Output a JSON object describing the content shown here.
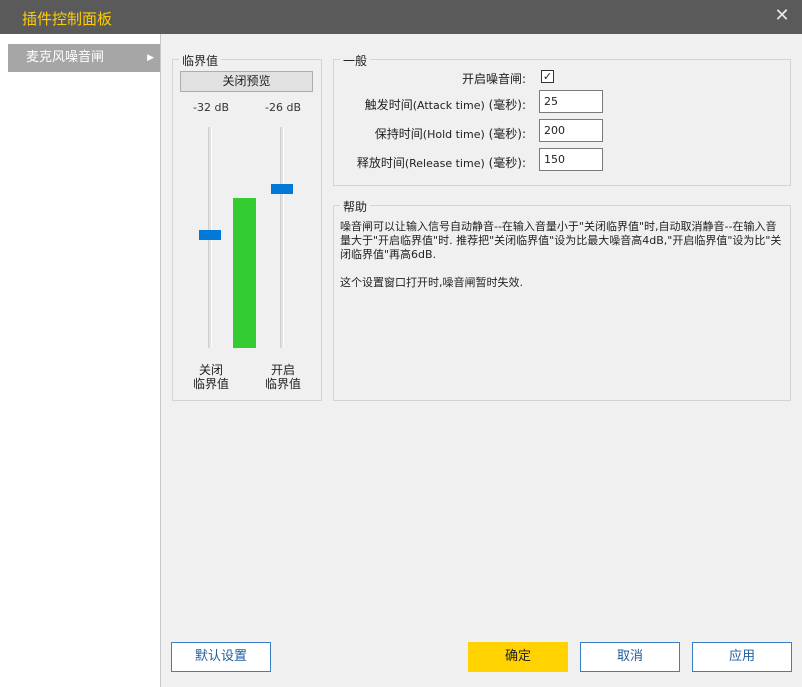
{
  "window": {
    "title": "插件控制面板",
    "close_symbol": "✕",
    "colors": {
      "titlebar": "#5a5a5a",
      "title_text": "#ffcc00",
      "accent": "#0078d7",
      "meter": "#33cc33",
      "ok_button": "#ffd200"
    }
  },
  "sidebar": {
    "items": [
      {
        "label": "麦克风噪音闸",
        "arrow": "▶",
        "selected": true
      }
    ]
  },
  "threshold": {
    "legend": "临界值",
    "preview_button": "关闭预览",
    "close_slider": {
      "db": "-32 dB",
      "name_line1": "关闭",
      "name_line2": "临界值",
      "level_fraction": 0.51
    },
    "open_slider": {
      "db": "-26 dB",
      "name_line1": "开启",
      "name_line2": "临界值",
      "level_fraction": 0.72
    },
    "meter_level_fraction": 0.68
  },
  "general": {
    "legend": "一般",
    "enable_label": "开启噪音闸:",
    "enable_checked": true,
    "check_symbol": "✓",
    "attack": {
      "label_cn": "触发时间",
      "label_en": "(Attack time)",
      "label_unit": " (毫秒):",
      "value": "25"
    },
    "hold": {
      "label_cn": "保持时间",
      "label_en": "(Hold time)",
      "label_unit": " (毫秒):",
      "value": "200"
    },
    "release": {
      "label_cn": "释放时间",
      "label_en": "(Release time)",
      "label_unit": " (毫秒):",
      "value": "150"
    }
  },
  "help": {
    "legend": "帮助",
    "paragraph1": "噪音闸可以让输入信号自动静音--在输入音量小于\"关闭临界值\"时,自动取消静音--在输入音量大于\"开启临界值\"时. 推荐把\"关闭临界值\"设为比最大噪音高4dB,\"开启临界值\"设为比\"关闭临界值\"再高6dB.",
    "paragraph2": "这个设置窗口打开时,噪音闸暂时失效."
  },
  "buttons": {
    "default": "默认设置",
    "ok": "确定",
    "cancel": "取消",
    "apply": "应用"
  }
}
